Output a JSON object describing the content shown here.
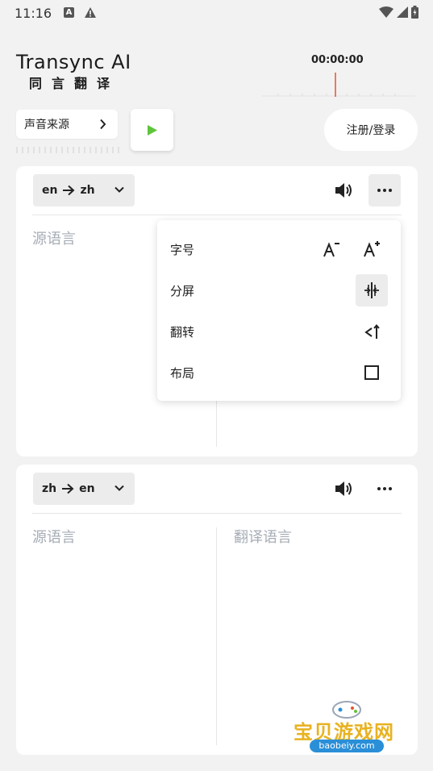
{
  "status_bar": {
    "time": "11:16"
  },
  "header": {
    "logo_en": "Transync AI",
    "logo_zh": "同言翻译",
    "timer": "00:00:00"
  },
  "controls": {
    "audio_source_label": "声音来源",
    "login_label": "注册/登录"
  },
  "panel_1": {
    "lang_from": "en",
    "lang_to": "zh",
    "source_placeholder": "源语言"
  },
  "menu": {
    "items": [
      {
        "label": "字号"
      },
      {
        "label": "分屏"
      },
      {
        "label": "翻转"
      },
      {
        "label": "布局"
      }
    ]
  },
  "panel_2": {
    "lang_from": "zh",
    "lang_to": "en",
    "source_placeholder": "源语言",
    "target_placeholder": "翻译语言"
  },
  "watermark": {
    "text": "宝贝游戏网",
    "url": "baobeiy.com"
  },
  "colors": {
    "play_green": "#5ec43a",
    "timeline_red": "#e2552b",
    "placeholder": "#a7adb6"
  }
}
